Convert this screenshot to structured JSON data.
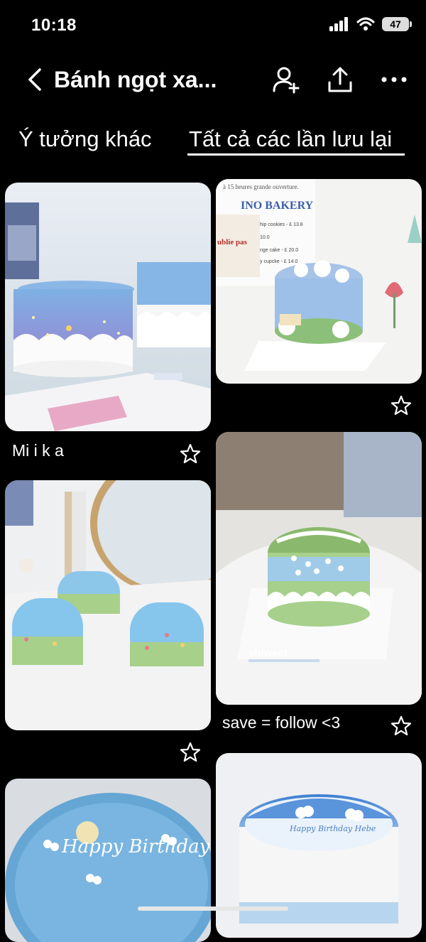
{
  "status": {
    "time": "10:18",
    "battery": "47"
  },
  "header": {
    "title": "Bánh ngọt xa..."
  },
  "tabs": [
    {
      "label": "Ý tưởng khác"
    },
    {
      "label": "Tất cả các lần lưu lại"
    }
  ],
  "pins": [
    {
      "title": "Mi i k a"
    },
    {
      "title": ""
    },
    {
      "title": ""
    },
    {
      "title": "save = follow <3"
    },
    {
      "title": ""
    },
    {
      "title": ""
    }
  ],
  "pin_text": {
    "bakery_sign": "à 15 heures grande ouverture.",
    "bakery_name": "INO BAKERY",
    "menu_card": "ublie pas",
    "menu_lines": [
      "hip cookies - £ 13.8",
      "10.0",
      "nge cake - £ 20.0",
      "y cupcke - £ 14.0"
    ],
    "brand": "shiweet",
    "cake5_text": "Happy Birthday",
    "cake6_text": "Happy Birthday Hebe"
  }
}
